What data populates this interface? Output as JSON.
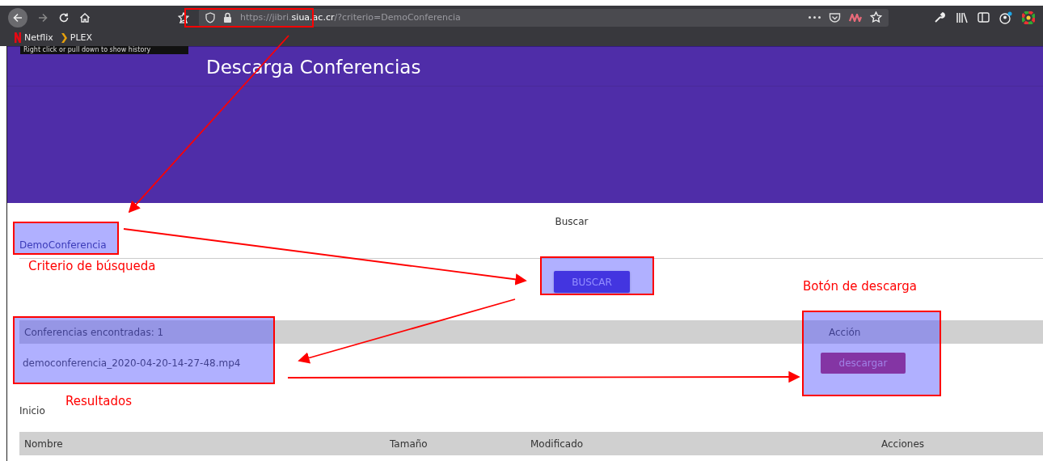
{
  "browser": {
    "url": {
      "prefix": "https://jibri.",
      "host": "siua.ac.cr",
      "path": "/?criterio=DemoConferencia"
    },
    "bookmarks": [
      "Netflix",
      "PLEX"
    ],
    "tooltip": "Right click or pull down to show history"
  },
  "header": {
    "title": "Descarga Conferencias"
  },
  "search": {
    "label": "Buscar",
    "value": "DemoConferencia",
    "button": "BUSCAR"
  },
  "results": {
    "columns": [
      "Conferencias encontradas: 1",
      "Acción"
    ],
    "rows": [
      {
        "name": "democonferencia_2020-04-20-14-27-48.mp4",
        "action": "descargar"
      }
    ]
  },
  "files": {
    "title": "Inicio",
    "columns": [
      "Nombre",
      "Tamaño",
      "Modificado",
      "Acciones"
    ]
  },
  "annotations": [
    {
      "label": "Criterio de búsqueda",
      "kind": "search"
    },
    {
      "label": "Botón de descarga",
      "kind": "download"
    },
    {
      "label": "Resultados",
      "kind": "results"
    }
  ]
}
